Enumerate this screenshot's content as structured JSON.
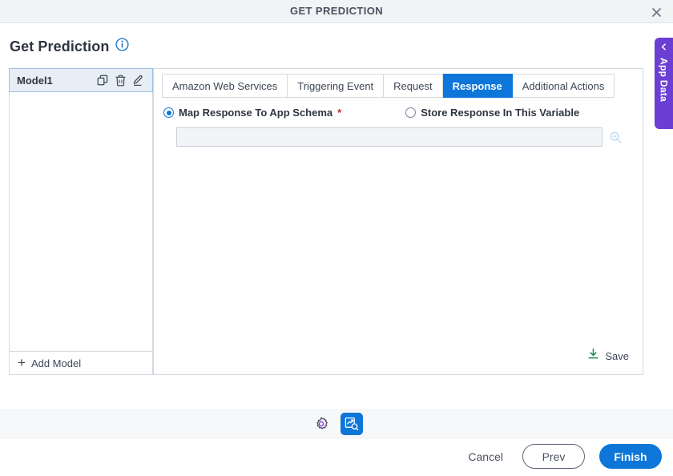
{
  "titlebar": {
    "title": "GET PREDICTION",
    "close_icon": "close-icon"
  },
  "page": {
    "heading": "Get Prediction",
    "info_icon": "info-icon"
  },
  "sidebar": {
    "models": [
      {
        "name": "Model1",
        "actions": [
          {
            "icon": "copy-icon",
            "label": "Copy"
          },
          {
            "icon": "trash-icon",
            "label": "Delete"
          },
          {
            "icon": "pencil-icon",
            "label": "Edit"
          }
        ]
      }
    ],
    "add_model_label": "Add Model",
    "add_model_icon": "plus-icon"
  },
  "content": {
    "tabs": [
      {
        "label": "Amazon Web Services",
        "active": false
      },
      {
        "label": "Triggering Event",
        "active": false
      },
      {
        "label": "Request",
        "active": false
      },
      {
        "label": "Response",
        "active": true
      },
      {
        "label": "Additional Actions",
        "active": false
      }
    ],
    "response_mode": {
      "options": [
        {
          "label": "Map Response To App Schema",
          "required": true,
          "selected": true
        },
        {
          "label": "Store Response In This Variable",
          "required": false,
          "selected": false
        }
      ],
      "required_marker": "*"
    },
    "schema_field": {
      "value": "",
      "placeholder": "",
      "search_icon": "search-icon"
    },
    "save": {
      "label": "Save",
      "icon": "save-download-icon"
    }
  },
  "app_data_tab": {
    "label": "App Data",
    "chevron_icon": "chevron-left-icon"
  },
  "toolbar": {
    "buttons": [
      {
        "icon": "gear-icon",
        "active": false
      },
      {
        "icon": "chart-preview-icon",
        "active": true
      }
    ]
  },
  "footer": {
    "cancel_label": "Cancel",
    "prev_label": "Prev",
    "finish_label": "Finish"
  },
  "colors": {
    "accent_blue": "#0d76d8",
    "purple": "#6c3fd4",
    "save_green": "#1f8a4c",
    "required_red": "#c8272d",
    "panel_border": "#d3d9e0"
  }
}
